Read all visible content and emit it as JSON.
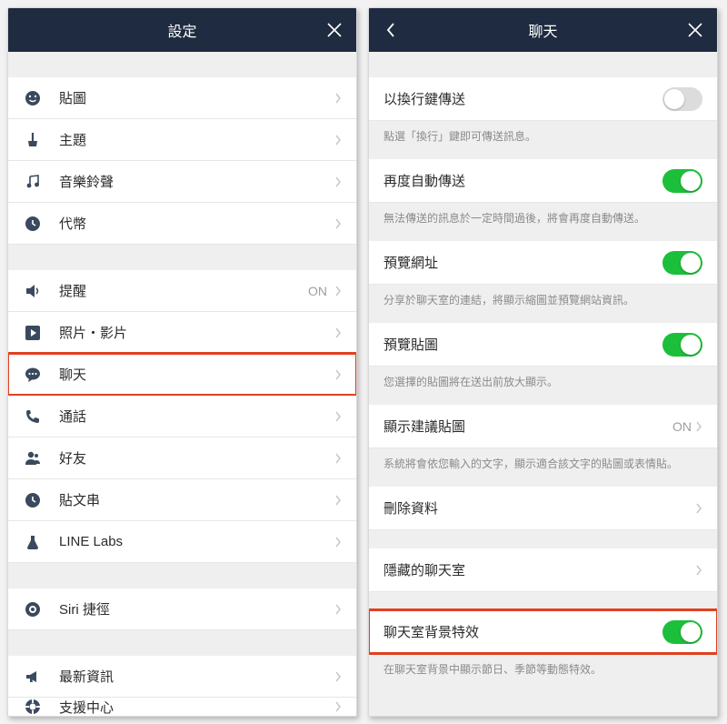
{
  "left": {
    "title": "設定",
    "groups": [
      [
        {
          "icon": "smile",
          "label": "貼圖"
        },
        {
          "icon": "brush",
          "label": "主題"
        },
        {
          "icon": "music",
          "label": "音樂鈴聲"
        },
        {
          "icon": "clock",
          "label": "代幣"
        }
      ],
      [
        {
          "icon": "speaker",
          "label": "提醒",
          "value": "ON"
        },
        {
          "icon": "play",
          "label": "照片・影片"
        },
        {
          "icon": "chat",
          "label": "聊天",
          "highlight": true
        },
        {
          "icon": "phone",
          "label": "通話"
        },
        {
          "icon": "person",
          "label": "好友"
        },
        {
          "icon": "clock",
          "label": "貼文串"
        },
        {
          "icon": "flask",
          "label": "LINE Labs"
        }
      ],
      [
        {
          "icon": "siri",
          "label": "Siri 捷徑"
        }
      ],
      [
        {
          "icon": "mega",
          "label": "最新資訊"
        },
        {
          "icon": "support",
          "label": "支援中心"
        }
      ]
    ]
  },
  "right": {
    "title": "聊天",
    "items": [
      {
        "label": "以換行鍵傳送",
        "toggle": "off",
        "desc": "點選「換行」鍵即可傳送訊息。"
      },
      {
        "label": "再度自動傳送",
        "toggle": "on",
        "desc": "無法傳送的訊息於一定時間過後，將會再度自動傳送。"
      },
      {
        "label": "預覽網址",
        "toggle": "on",
        "desc": "分享於聊天室的連結，將顯示縮圖並預覽網站資訊。"
      },
      {
        "label": "預覽貼圖",
        "toggle": "on",
        "desc": "您選擇的貼圖將在送出前放大顯示。"
      },
      {
        "label": "顯示建議貼圖",
        "value": "ON",
        "chev": true,
        "desc": "系統將會依您輸入的文字，顯示適合該文字的貼圖或表情貼。"
      },
      {
        "label": "刪除資料",
        "chev": true
      },
      {
        "gap": true
      },
      {
        "label": "隱藏的聊天室",
        "chev": true
      },
      {
        "gap": true
      },
      {
        "label": "聊天室背景特效",
        "toggle": "on",
        "highlight": true,
        "desc": "在聊天室背景中顯示節日、季節等動態特效。"
      }
    ]
  }
}
